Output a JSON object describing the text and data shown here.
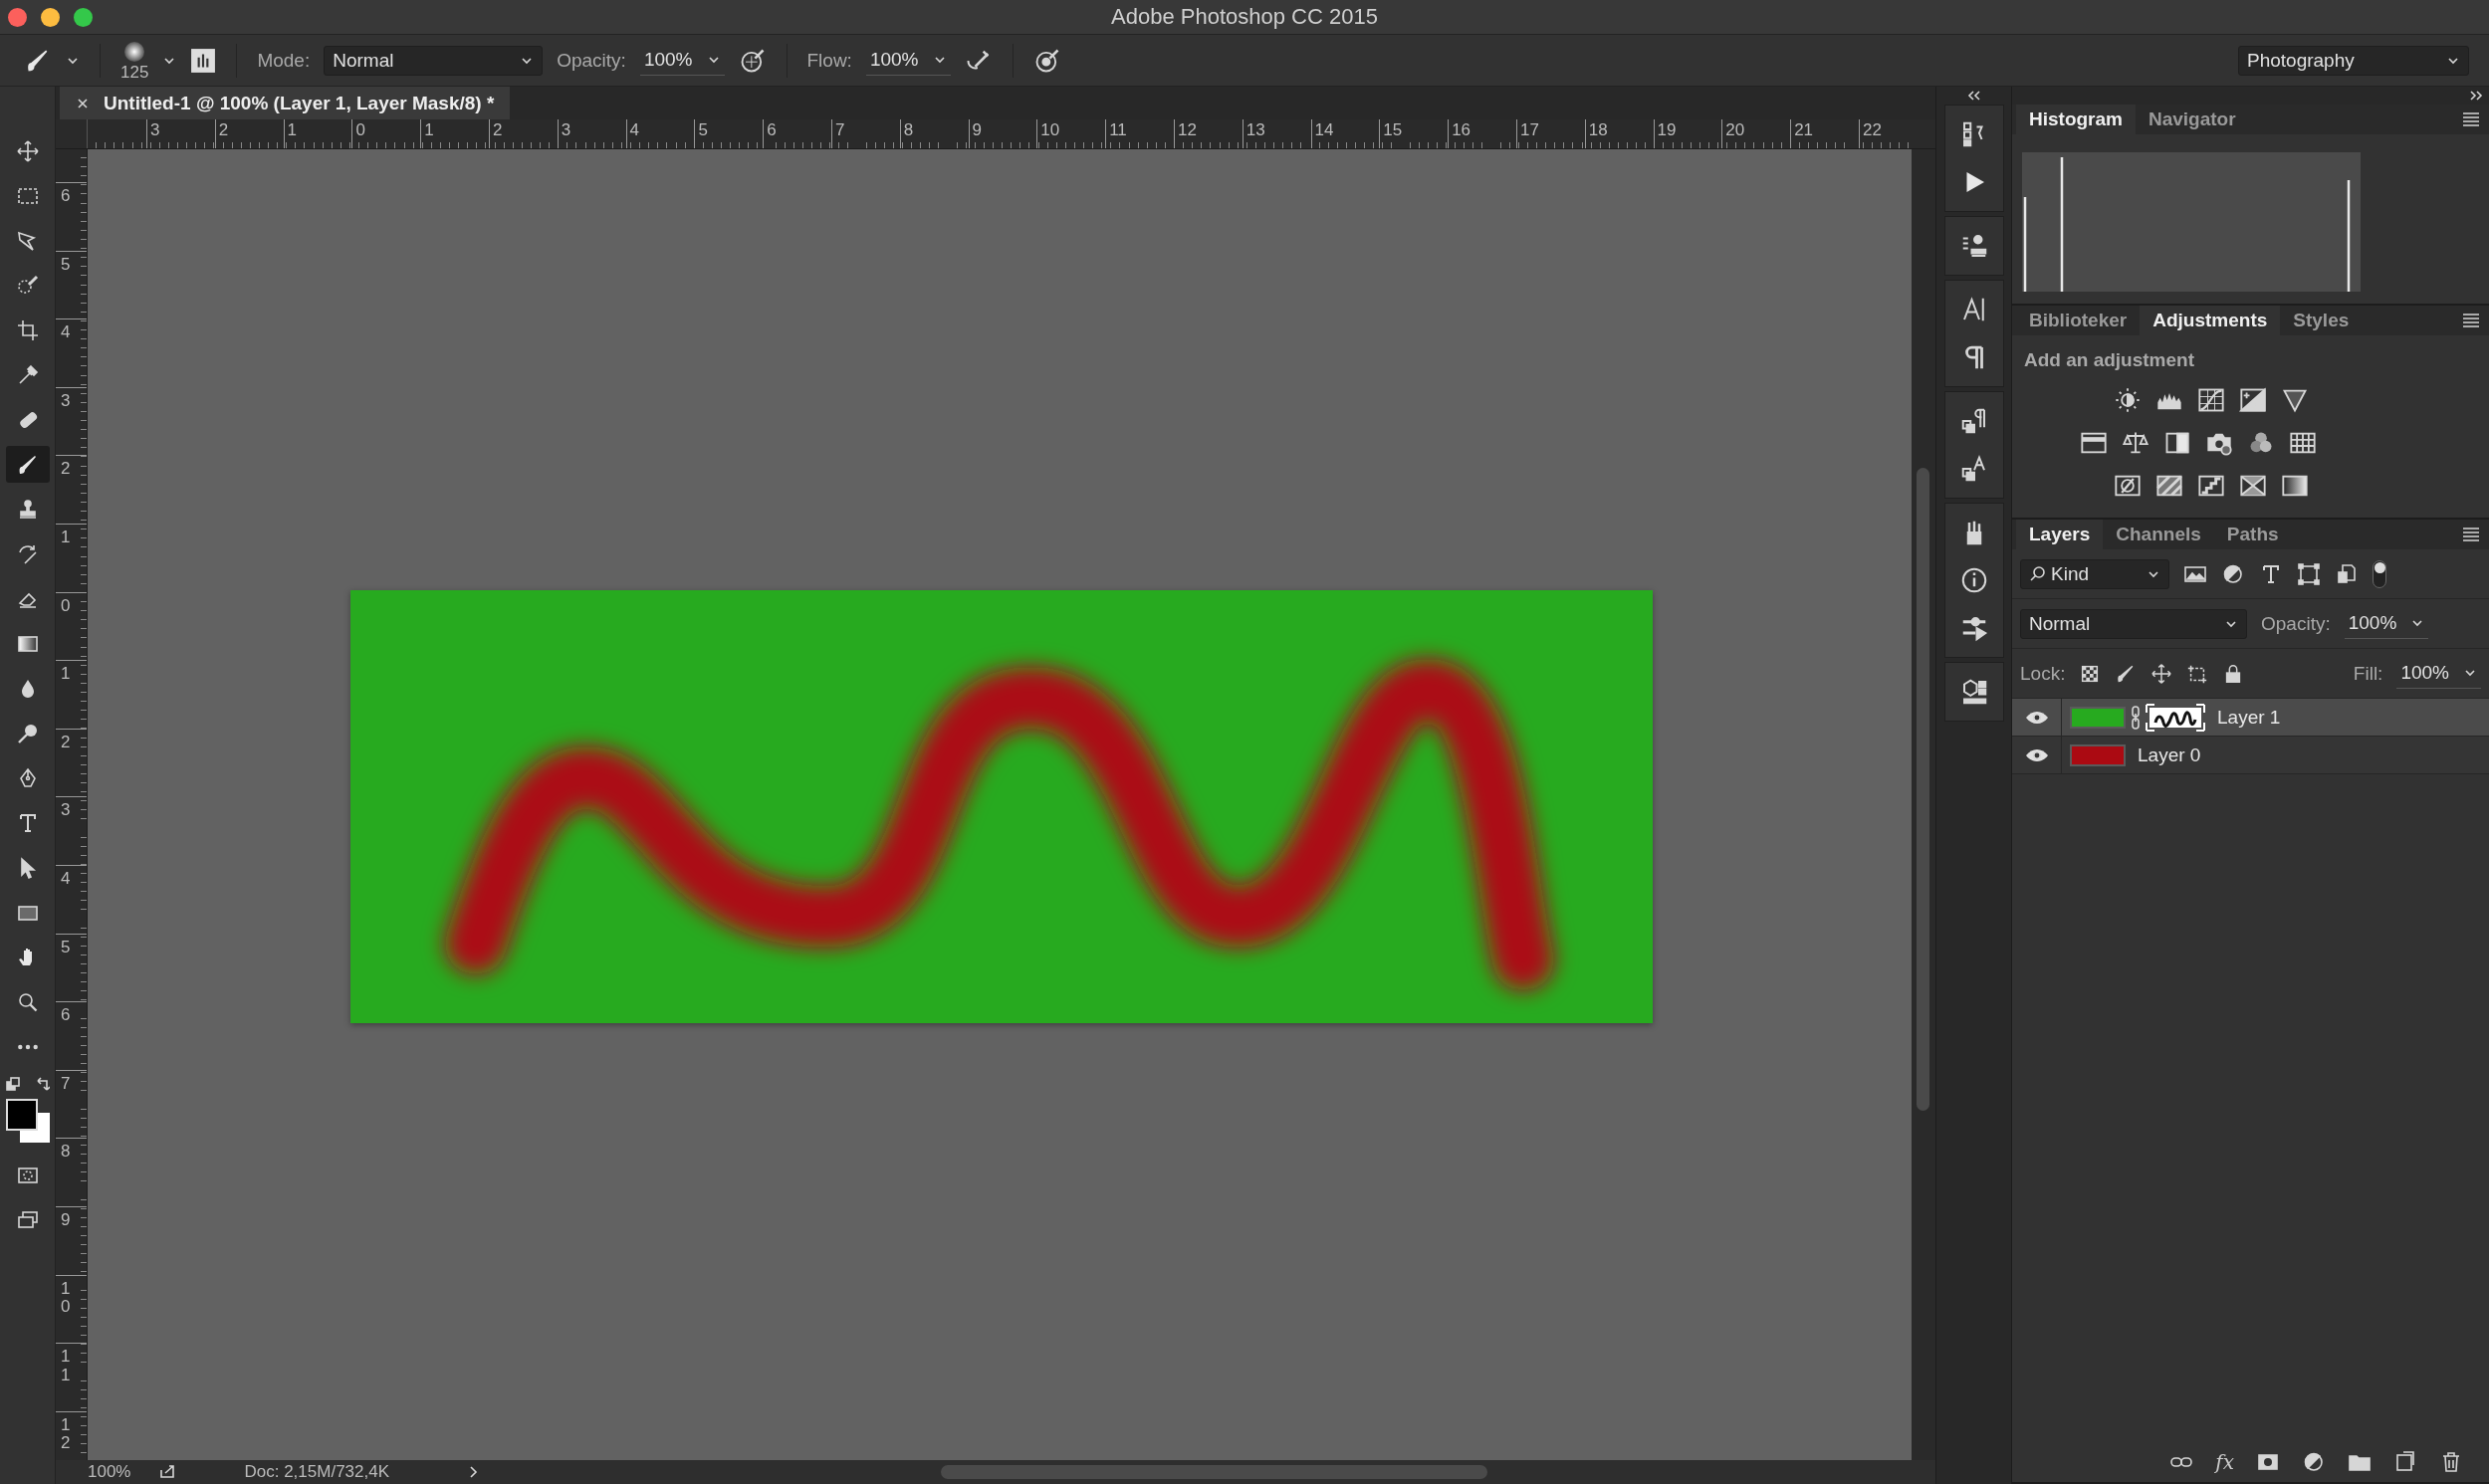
{
  "window": {
    "title": "Adobe Photoshop CC 2015"
  },
  "options_bar": {
    "brush_size": "125",
    "mode_label": "Mode:",
    "mode": "Normal",
    "opacity_label": "Opacity:",
    "opacity": "100%",
    "flow_label": "Flow:",
    "flow": "100%",
    "workspace": "Photography"
  },
  "tools": [
    {
      "selected": false
    },
    {
      "selected": false
    },
    {
      "selected": false
    },
    {
      "selected": false
    },
    {
      "selected": false
    },
    {
      "selected": false
    },
    {
      "selected": false
    },
    {
      "selected": true
    },
    {
      "selected": false
    },
    {
      "selected": false
    },
    {
      "selected": false
    },
    {
      "selected": false
    },
    {
      "selected": false
    },
    {
      "selected": false
    },
    {
      "selected": false
    },
    {
      "selected": false
    },
    {
      "selected": false
    },
    {
      "selected": false
    },
    {
      "selected": false
    },
    {
      "selected": false
    },
    {
      "selected": false
    }
  ],
  "document": {
    "tab_title": "Untitled-1 @ 100% (Layer 1, Layer Mask/8) *"
  },
  "rulers": {
    "horizontal": [
      "3",
      "2",
      "1",
      "0",
      "1",
      "2",
      "3",
      "4",
      "5",
      "6",
      "7",
      "8",
      "9",
      "10",
      "11",
      "12",
      "13",
      "14",
      "15",
      "16",
      "17",
      "18",
      "19",
      "20",
      "21",
      "22"
    ],
    "vertical": [
      "6",
      "5",
      "4",
      "3",
      "2",
      "1",
      "0",
      "1",
      "2",
      "3",
      "4",
      "5",
      "6",
      "7",
      "8",
      "9",
      "10",
      "11",
      "12"
    ]
  },
  "status_bar": {
    "zoom": "100%",
    "doc_info": "Doc: 2,15M/732,4K"
  },
  "histogram_panel": {
    "tabs": [
      {
        "label": "Histogram",
        "selected": true
      },
      {
        "label": "Navigator",
        "selected": false
      }
    ]
  },
  "adjustments_panel": {
    "tabs": [
      {
        "label": "Biblioteker",
        "selected": false
      },
      {
        "label": "Adjustments",
        "selected": true
      },
      {
        "label": "Styles",
        "selected": false
      }
    ],
    "heading": "Add an adjustment"
  },
  "layers_panel": {
    "tabs": [
      {
        "label": "Layers",
        "selected": true
      },
      {
        "label": "Channels",
        "selected": false
      },
      {
        "label": "Paths",
        "selected": false
      }
    ],
    "filter": "Kind",
    "blend_mode": "Normal",
    "opacity_label": "Opacity:",
    "opacity": "100%",
    "lock_label": "Lock:",
    "fill_label": "Fill:",
    "fill": "100%",
    "layers": [
      {
        "name": "Layer 1",
        "selected": true,
        "visible": true,
        "color": "#27aa1f",
        "mask": true
      },
      {
        "name": "Layer 0",
        "selected": false,
        "visible": true,
        "color": "#ab0a12",
        "mask": false
      }
    ],
    "footer_fx": "fx"
  }
}
